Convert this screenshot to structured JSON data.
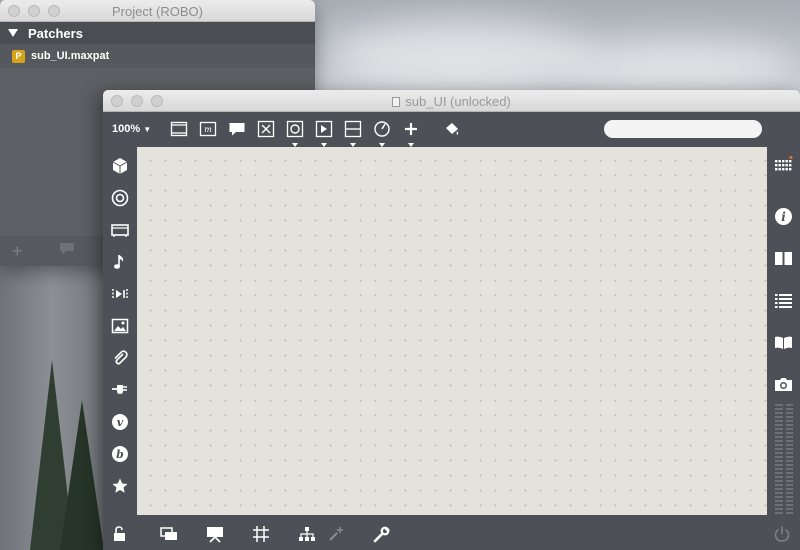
{
  "project_window": {
    "title": "Project (ROBO)",
    "section_header": "Patchers",
    "items": [
      {
        "badge": "P",
        "name": "sub_UI.maxpat"
      }
    ],
    "footer_icons": [
      "plus-icon",
      "comment-icon"
    ]
  },
  "patcher_window": {
    "title": "sub_UI (unlocked)",
    "zoom": "100%",
    "search": {
      "value": "",
      "placeholder": ""
    },
    "toolbar_icons": [
      "new-object-icon",
      "message-icon",
      "comment-icon",
      "toggle-icon",
      "button-icon",
      "slider-icon",
      "number-icon",
      "dial-icon",
      "add-icon",
      "paint-bucket-icon"
    ],
    "left_sidebar_icons": [
      "cube-icon",
      "target-icon",
      "video-icon",
      "music-note-icon",
      "step-sequence-icon",
      "image-icon",
      "paperclip-icon",
      "plug-icon",
      "v-badge-icon",
      "b-badge-icon",
      "star-icon"
    ],
    "right_sidebar_icons": [
      "grid-icon",
      "info-icon",
      "book-icon",
      "list-icon",
      "reference-book-icon",
      "camera-icon"
    ],
    "bottom_icons": [
      "lock-icon",
      "presentation-windows-icon",
      "presentation-mode-icon",
      "grid-snap-icon",
      "hierarchy-icon",
      "wand-icon",
      "wrench-icon",
      "power-icon"
    ],
    "left_icon_labels": {
      "v": "v",
      "b": "b"
    },
    "colors": {
      "chrome": "#4d5157",
      "canvas": "#e3e3db",
      "dot_grid": "#b9b9b1",
      "patcher_badge": "#d6a21a"
    }
  }
}
